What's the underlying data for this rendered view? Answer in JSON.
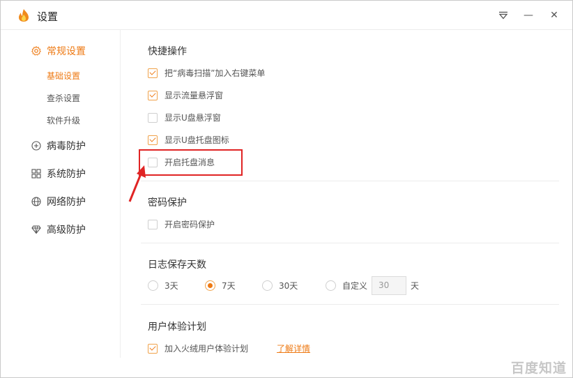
{
  "window": {
    "title": "设置"
  },
  "titlebar": {
    "menu_icon": "dropdown-triangle-icon",
    "minimize_glyph": "—",
    "close_glyph": "✕"
  },
  "sidebar": {
    "accent": "#ee7a14",
    "items": [
      {
        "label": "常规设置",
        "icon": "gear-icon",
        "active": true,
        "children": [
          {
            "label": "基础设置",
            "active": true
          },
          {
            "label": "查杀设置",
            "active": false
          },
          {
            "label": "软件升级",
            "active": false
          }
        ]
      },
      {
        "label": "病毒防护",
        "icon": "plus-circle-icon"
      },
      {
        "label": "系统防护",
        "icon": "grid-icon"
      },
      {
        "label": "网络防护",
        "icon": "globe-icon"
      },
      {
        "label": "高级防护",
        "icon": "diamond-icon"
      }
    ]
  },
  "main": {
    "quick_ops": {
      "title": "快捷操作",
      "options": [
        {
          "label": "把“病毒扫描”加入右键菜单",
          "checked": true
        },
        {
          "label": "显示流量悬浮窗",
          "checked": true
        },
        {
          "label": "显示U盘悬浮窗",
          "checked": false
        },
        {
          "label": "显示U盘托盘图标",
          "checked": true
        },
        {
          "label": "开启托盘消息",
          "checked": false
        }
      ]
    },
    "password": {
      "title": "密码保护",
      "option": {
        "label": "开启密码保护",
        "checked": false
      }
    },
    "log_days": {
      "title": "日志保存天数",
      "options": [
        {
          "label": "3天",
          "selected": false
        },
        {
          "label": "7天",
          "selected": true
        },
        {
          "label": "30天",
          "selected": false
        },
        {
          "label": "自定义",
          "selected": false
        }
      ],
      "custom_value": "30",
      "unit": "天"
    },
    "ux_plan": {
      "title": "用户体验计划",
      "option": {
        "label": "加入火绒用户体验计划",
        "checked": true
      },
      "link": "了解详情"
    }
  },
  "annotation": {
    "color": "#e02424"
  },
  "watermark": "百度知道"
}
